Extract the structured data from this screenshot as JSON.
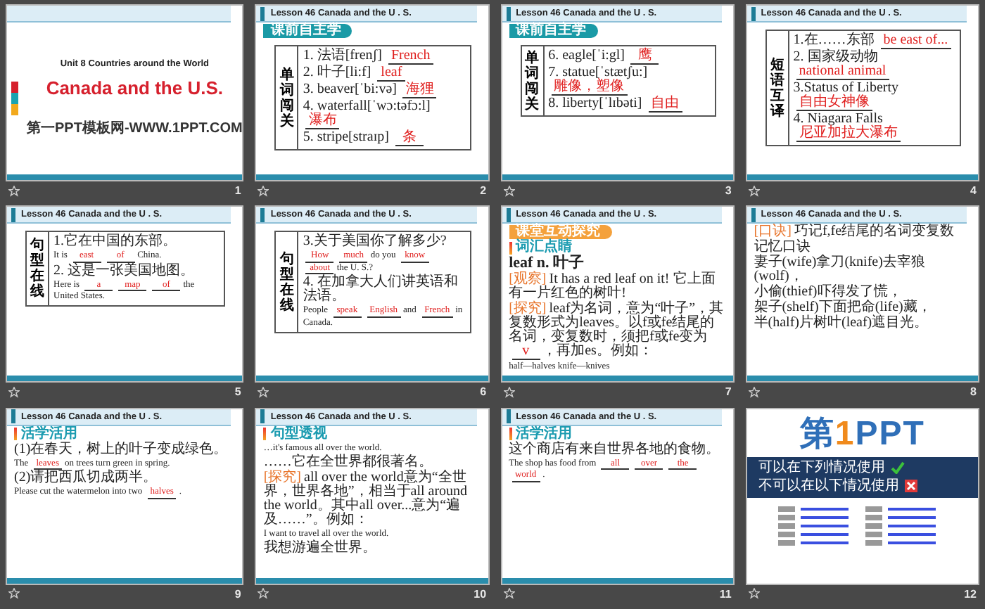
{
  "slides": [
    {
      "number": "1",
      "kind": "title",
      "unit": "Unit 8 Countries around the World",
      "title": "Canada and the U.S.",
      "footer": "第一PPT模板网-WWW.1PPT.COM"
    },
    {
      "number": "2",
      "kind": "lesson",
      "header": "Lesson 46   Canada and the U . S.",
      "badge": {
        "text": "课前自主学",
        "color": "#1a9aa6"
      },
      "blocks": [
        {
          "kind": "table",
          "side": "单词闯关",
          "lines": [
            {
              "segments": [
                {
                  "t": "1. 法语[frenʃ]"
                },
                {
                  "a": "French"
                }
              ]
            },
            {
              "segments": [
                {
                  "t": "2. 叶子[li:f]"
                },
                {
                  "a": "leaf"
                }
              ]
            },
            {
              "segments": [
                {
                  "t": "3. beaver[ˈbi:və]"
                },
                {
                  "a": "海狸"
                }
              ]
            },
            {
              "segments": [
                {
                  "t": "4. waterfall[ˈwɔ:təfɔ:l]"
                },
                {
                  "a": "瀑布"
                }
              ]
            },
            {
              "segments": [
                {
                  "t": "5. stripe[straɪp]"
                },
                {
                  "a": "条"
                }
              ]
            }
          ]
        }
      ]
    },
    {
      "number": "3",
      "kind": "lesson",
      "header": "Lesson 46   Canada and the U . S.",
      "badge": {
        "text": "课前自主学",
        "color": "#1a9aa6"
      },
      "blocks": [
        {
          "kind": "table",
          "side": "单词闯关",
          "lines": [
            {
              "segments": [
                {
                  "t": "6. eagle[ˈi:gl]"
                },
                {
                  "a": "鹰"
                }
              ]
            },
            {
              "segments": [
                {
                  "t": "7. statue[ˈstætʃu:]"
                },
                {
                  "a": "雕像，塑像"
                }
              ]
            },
            {
              "segments": [
                {
                  "t": "8. liberty[ˈlɪbəti]"
                },
                {
                  "a": "自由"
                }
              ]
            }
          ]
        }
      ]
    },
    {
      "number": "4",
      "kind": "lesson",
      "header": "Lesson 46   Canada and the U . S.",
      "blocks": [
        {
          "kind": "table",
          "side": "短语互译",
          "lines": [
            {
              "segments": [
                {
                  "t": "1.在……东部"
                },
                {
                  "a": "be east of..."
                }
              ]
            },
            {
              "segments": [
                {
                  "t": "2. 国家级动物"
                },
                {
                  "a": "national animal"
                }
              ]
            },
            {
              "segments": [
                {
                  "t": "3.Status of Liberty"
                },
                {
                  "a": "自由女神像"
                }
              ]
            },
            {
              "segments": [
                {
                  "t": "4. Niagara Falls"
                },
                {
                  "a": "尼亚加拉大瀑布"
                }
              ]
            }
          ]
        }
      ]
    },
    {
      "number": "5",
      "kind": "lesson",
      "header": "Lesson 46   Canada and the U . S.",
      "blocks": [
        {
          "kind": "table",
          "side": "句型在线",
          "lines": [
            {
              "segments": [
                {
                  "t": "1.它在中国的东部。"
                }
              ]
            },
            {
              "segments": [
                {
                  "t": "It is"
                },
                {
                  "a": "east"
                },
                {
                  "a": "of"
                },
                {
                  "t": "China."
                }
              ]
            },
            {
              "segments": [
                {
                  "t": "2. 这是一张美国地图。"
                }
              ]
            },
            {
              "segments": [
                {
                  "t": "Here is"
                },
                {
                  "a": "a"
                },
                {
                  "a": "map"
                },
                {
                  "a": "of"
                },
                {
                  "t": "the United States."
                }
              ]
            }
          ]
        }
      ]
    },
    {
      "number": "6",
      "kind": "lesson",
      "header": "Lesson 46   Canada and the U . S.",
      "blocks": [
        {
          "kind": "table",
          "side": "句型在线",
          "lines": [
            {
              "segments": [
                {
                  "t": "3.关于美国你了解多少?"
                }
              ]
            },
            {
              "segments": [
                {
                  "a": "How"
                },
                {
                  "a": "much"
                },
                {
                  "t": "do you"
                },
                {
                  "a": "know"
                },
                {
                  "a": "about"
                },
                {
                  "t": "the U. S.?"
                }
              ]
            },
            {
              "segments": [
                {
                  "t": "4. 在加拿大人们讲英语和法语。"
                }
              ]
            },
            {
              "segments": [
                {
                  "t": "People"
                },
                {
                  "a": "speak"
                },
                {
                  "a": "English"
                },
                {
                  "t": "and"
                },
                {
                  "a": "French"
                },
                {
                  "t": "in Canada."
                }
              ]
            }
          ]
        }
      ]
    },
    {
      "number": "7",
      "kind": "lesson",
      "header": "Lesson 46   Canada and the U . S.",
      "badge": {
        "text": "课堂互动探究",
        "color": "#f4a13c"
      },
      "blocks": [
        {
          "kind": "heading",
          "text": "词汇点睛"
        },
        {
          "kind": "word",
          "segments": [
            {
              "t": "leaf n. 叶子"
            }
          ]
        },
        {
          "kind": "line",
          "segments": [
            {
              "tag": "[观察]"
            },
            {
              "t": "It has a red leaf on it! 它上面有一片红色的树叶!"
            }
          ]
        },
        {
          "kind": "line",
          "segments": [
            {
              "tag": "[探究]"
            },
            {
              "t": "leaf为名词，意为“叶子”，其复数形式为leaves。以f或fe结尾的名词，变复数时，须把f或fe变为"
            },
            {
              "a": "v"
            },
            {
              "t": "，再加es。例如："
            }
          ]
        },
        {
          "kind": "line",
          "segments": [
            {
              "t": "half—halves   knife—knives"
            }
          ]
        }
      ]
    },
    {
      "number": "8",
      "kind": "lesson",
      "header": "Lesson 46   Canada and the U . S.",
      "blocks": [
        {
          "kind": "line",
          "segments": [
            {
              "tag": "[口诀]"
            },
            {
              "t": "巧记f,fe结尾的名词变复数"
            }
          ]
        },
        {
          "kind": "line",
          "segments": [
            {
              "t": "记忆口诀"
            }
          ]
        },
        {
          "kind": "line",
          "segments": [
            {
              "t": "妻子(wife)拿刀(knife)去宰狼(wolf)，"
            }
          ]
        },
        {
          "kind": "line",
          "segments": [
            {
              "t": "小偷(thief)吓得发了慌，"
            }
          ]
        },
        {
          "kind": "line",
          "segments": [
            {
              "t": "架子(shelf)下面把命(life)藏，"
            }
          ]
        },
        {
          "kind": "line",
          "segments": [
            {
              "t": "半(half)片树叶(leaf)遮目光。"
            }
          ]
        }
      ]
    },
    {
      "number": "9",
      "kind": "lesson",
      "header": "Lesson 46   Canada and the U . S.",
      "blocks": [
        {
          "kind": "heading",
          "text": "活学活用"
        },
        {
          "kind": "line",
          "segments": [
            {
              "t": "(1)在春天，树上的叶子变成绿色。"
            }
          ]
        },
        {
          "kind": "line",
          "segments": [
            {
              "t": "The"
            },
            {
              "a": "leaves"
            },
            {
              "t": "on trees turn green in spring."
            }
          ]
        },
        {
          "kind": "line",
          "segments": [
            {
              "t": "(2)请把西瓜切成两半。"
            }
          ]
        },
        {
          "kind": "line",
          "segments": [
            {
              "t": "Please cut the watermelon into two"
            },
            {
              "a": "halves"
            },
            {
              "t": "."
            }
          ]
        }
      ]
    },
    {
      "number": "10",
      "kind": "lesson",
      "header": "Lesson 46   Canada and the U . S.",
      "blocks": [
        {
          "kind": "heading",
          "text": "句型透视"
        },
        {
          "kind": "line",
          "segments": [
            {
              "t": "…it's famous all over the world."
            }
          ]
        },
        {
          "kind": "line",
          "segments": [
            {
              "t": "……它在全世界都很著名。"
            }
          ]
        },
        {
          "kind": "line",
          "segments": [
            {
              "tag": "[探究]"
            },
            {
              "t": "all over the world意为“全世界，世界各地”，相当于all around the world。其中all over...意为“遍及……”。例如："
            }
          ]
        },
        {
          "kind": "line",
          "segments": [
            {
              "t": "I want to travel all over the world."
            }
          ]
        },
        {
          "kind": "line",
          "segments": [
            {
              "t": "我想游遍全世界。"
            }
          ]
        }
      ]
    },
    {
      "number": "11",
      "kind": "lesson",
      "header": "Lesson 46   Canada and the U . S.",
      "blocks": [
        {
          "kind": "heading",
          "text": "活学活用"
        },
        {
          "kind": "line",
          "segments": [
            {
              "t": "这个商店有来自世界各地的食物。"
            }
          ]
        },
        {
          "kind": "line",
          "segments": [
            {
              "t": "The shop has food from"
            },
            {
              "a": "all"
            },
            {
              "a": "over"
            },
            {
              "a": "the"
            },
            {
              "a": "world"
            },
            {
              "t": "."
            }
          ]
        }
      ]
    },
    {
      "number": "12",
      "kind": "ad",
      "logo": [
        {
          "text": "第",
          "color": "#2f6fb8"
        },
        {
          "text": "1",
          "color": "#f08a1c"
        },
        {
          "text": "PPT",
          "color": "#2f6fb8"
        }
      ],
      "band": [
        {
          "heading": "可以在下列情况使用",
          "kind": "check"
        },
        {
          "heading": "不可以在以下情况使用",
          "kind": "cross"
        }
      ]
    }
  ]
}
